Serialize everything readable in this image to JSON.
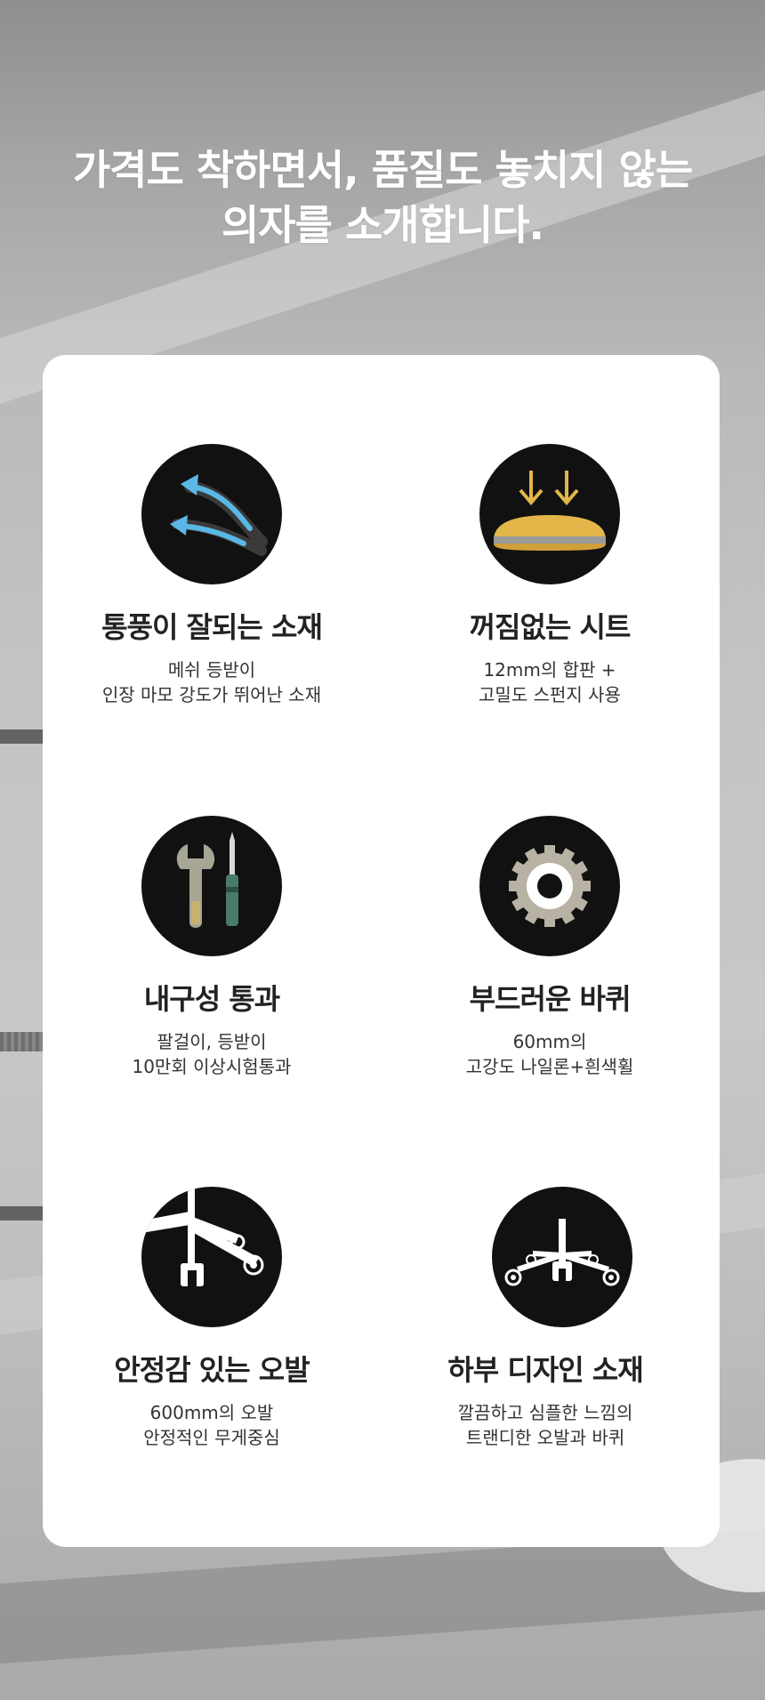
{
  "headline": {
    "line1": "가격도 착하면서, 품질도 놓치지 않는",
    "line2": "의자를 소개합니다."
  },
  "features": [
    {
      "icon": "airflow-arrows-icon",
      "title": "통풍이 잘되는 소재",
      "desc1": "메쉬 등받이",
      "desc2": "인장 마모 강도가 뛰어난 소재"
    },
    {
      "icon": "seat-cushion-icon",
      "title": "꺼짐없는 시트",
      "desc1": "12mm의 합판 +",
      "desc2": "고밀도 스펀지 사용"
    },
    {
      "icon": "tools-icon",
      "title": "내구성 통과",
      "desc1": "팔걸이, 등받이",
      "desc2": "10만회 이상시험통과"
    },
    {
      "icon": "wheel-icon",
      "title": "부드러운 바퀴",
      "desc1": "60mm의",
      "desc2": "고강도 나일론+흰색휠"
    },
    {
      "icon": "chair-base-icon",
      "title": "안정감 있는 오발",
      "desc1": "600mm의 오발",
      "desc2": "안정적인 무게중심"
    },
    {
      "icon": "chair-base-design-icon",
      "title": "하부 디자인 소재",
      "desc1": "깔끔하고 심플한 느낌의",
      "desc2": "트랜디한 오발과 바퀴"
    }
  ],
  "colors": {
    "card": "#ffffff",
    "icon_bg": "#111111",
    "title": "#222222",
    "accent_blue": "#5ab8e6",
    "accent_yellow": "#e3b64a"
  }
}
